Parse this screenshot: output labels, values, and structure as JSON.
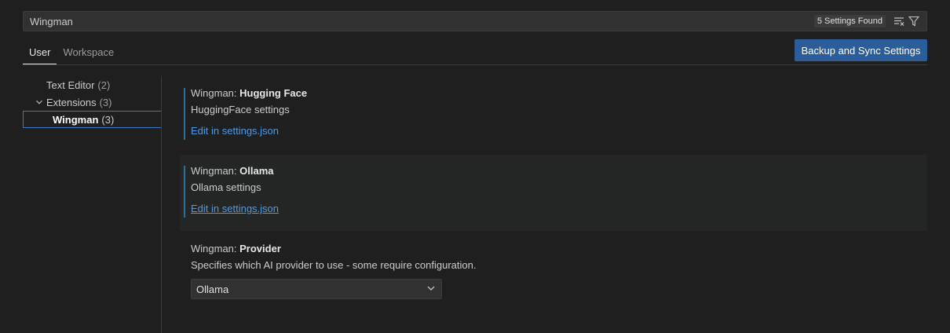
{
  "search": {
    "value": "Wingman",
    "count_label": "5 Settings Found",
    "clear_icon": "clear-filter-icon",
    "filter_icon": "filter-icon"
  },
  "tabs": [
    {
      "label": "User"
    },
    {
      "label": "Workspace"
    }
  ],
  "sync_button": {
    "label": "Backup and Sync Settings"
  },
  "toc": [
    {
      "label": "Text Editor",
      "count": "(2)"
    },
    {
      "label": "Extensions",
      "count": "(3)"
    },
    {
      "label": "Wingman",
      "count": "(3)"
    }
  ],
  "settings": [
    {
      "prefix": "Wingman: ",
      "name": "Hugging Face",
      "description": "HuggingFace settings",
      "link": "Edit in settings.json"
    },
    {
      "prefix": "Wingman: ",
      "name": "Ollama",
      "description": "Ollama settings",
      "link": "Edit in settings.json"
    },
    {
      "prefix": "Wingman: ",
      "name": "Provider",
      "description": "Specifies which AI provider to use - some require configuration.",
      "select_value": "Ollama"
    }
  ],
  "colors": {
    "accent": "#2a5d9a",
    "link": "#4c9be8",
    "background": "#1f1f1f"
  }
}
